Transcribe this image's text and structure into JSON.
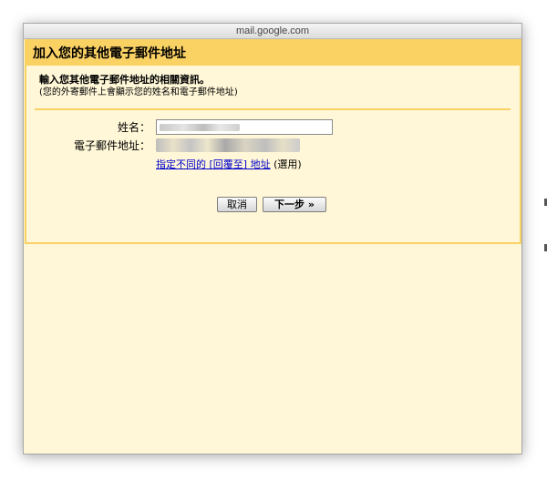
{
  "window": {
    "url": "mail.google.com"
  },
  "dialog": {
    "title": "加入您的其他電子郵件地址",
    "intro_heading": "輸入您其他電子郵件地址的相關資訊。",
    "intro_subtext": "(您的外寄郵件上會顯示您的姓名和電子郵件地址)",
    "form": {
      "name_label": "姓名：",
      "email_label": "電子郵件地址："
    },
    "reply_to_link": "指定不同的 [回覆至] 地址",
    "optional_note": "(選用)",
    "buttons": {
      "cancel": "取消",
      "next": "下一步 »"
    }
  },
  "colors": {
    "dialog_accent": "#fad163",
    "dialog_background": "#fff7d7",
    "link": "#0000cc"
  }
}
